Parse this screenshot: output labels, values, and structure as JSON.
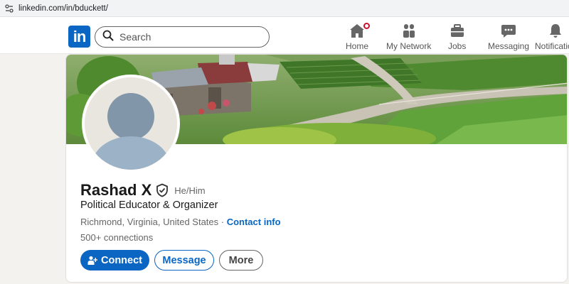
{
  "browser": {
    "url": "linkedin.com/in/bduckett/"
  },
  "nav": {
    "logo": "in",
    "search_placeholder": "Search",
    "items": [
      {
        "label": "Home",
        "icon": "home-icon"
      },
      {
        "label": "My Network",
        "icon": "network-icon"
      },
      {
        "label": "Jobs",
        "icon": "briefcase-icon"
      },
      {
        "label": "Messaging",
        "icon": "messaging-icon"
      },
      {
        "label": "Notifications",
        "icon": "bell-icon"
      }
    ]
  },
  "profile": {
    "name": "Rashad X",
    "pronouns": "He/Him",
    "headline": "Political Educator & Organizer",
    "location": "Richmond, Virginia, United States",
    "separator": " · ",
    "contact_info": "Contact info",
    "connections": "500+ connections"
  },
  "actions": {
    "connect": "Connect",
    "message": "Message",
    "more": "More"
  },
  "colors": {
    "brand": "#0a66c2",
    "badge": "#cb112d"
  }
}
